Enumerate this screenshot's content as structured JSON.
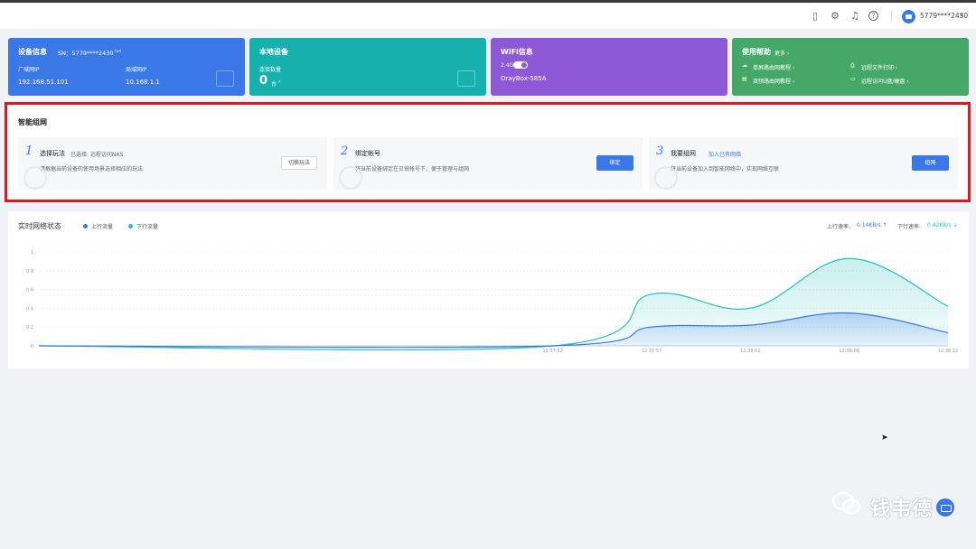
{
  "header": {
    "username": "5779****2430",
    "icons": [
      "phone-icon",
      "plugin-icon",
      "bell-icon",
      "help-icon",
      "user-avatar-icon"
    ]
  },
  "cards": {
    "device": {
      "title": "设备信息",
      "sn": "SN：5779****2430",
      "sn_tag": "fwd",
      "wan_label": "广域网IP",
      "wan_value": "192.168.51.101",
      "lan_label": "局域网IP",
      "lan_value": "10.168.1.1"
    },
    "local": {
      "title": "本地设备",
      "count_label": "连接数量",
      "count_value": "0",
      "count_unit": "台",
      "chevron": "›"
    },
    "wifi": {
      "title": "WiFi信息",
      "band": "2.4G",
      "ssid": "OrayBox-585A"
    },
    "help": {
      "title": "使用帮助",
      "more": "更多 ›",
      "links": [
        "单屏路由网教程 ›",
        "双频路由网教程 ›",
        "远程文件打印 ›",
        "远程访问U盘/硬盘 ›"
      ]
    }
  },
  "mesh": {
    "title": "智能组网",
    "steps": [
      {
        "num": "1",
        "title": "选择玩法",
        "extra": "已选择:    远程访问NAS",
        "desc": "请根据当前设备的使用场景选择相应的玩法",
        "button": "切换玩法"
      },
      {
        "num": "2",
        "title": "绑定帐号",
        "desc": "将当前设备绑定在贝锐帐号下，便于管理与组网",
        "button": "绑定"
      },
      {
        "num": "3",
        "title": "我要组网",
        "link": "加入已有网络",
        "desc": "将当前设备加入到智能网络中，实现网络互联",
        "button": "组网"
      }
    ]
  },
  "network": {
    "title": "实时网络状态",
    "legend_up": "上行流量",
    "legend_down": "下行流量",
    "up_rate_label": "上行速率:",
    "up_rate_value": "0.14KB/s ↑",
    "down_rate_label": "下行速率:",
    "down_rate_value": "0.42KB/s ↓",
    "colors": {
      "up": "#3b78e7",
      "down": "#25c1b8"
    }
  },
  "chart_data": {
    "type": "area",
    "title": "实时网络状态",
    "xlabel": "",
    "ylabel": "",
    "ylim": [
      0,
      1
    ],
    "y_ticks": [
      "0",
      "0.2",
      "0.4",
      "0.6",
      "0.8",
      "1"
    ],
    "x_ticks": [
      "12:37:52",
      "12:37:57",
      "12:38:02",
      "12:38:08",
      "12:38:12"
    ],
    "x_tick_positions": [
      0,
      5,
      10,
      15,
      20
    ],
    "x_range": [
      -26,
      20
    ],
    "grid": true,
    "legend_position": "top-left",
    "series": [
      {
        "name": "上行流量",
        "x": [
          -26,
          0,
          5,
          10,
          15,
          20
        ],
        "values": [
          0,
          0,
          0.2,
          0.22,
          0.35,
          0.14
        ]
      },
      {
        "name": "下行流量",
        "x": [
          -26,
          0,
          5,
          10,
          15,
          20
        ],
        "values": [
          0,
          0,
          0.55,
          0.4,
          0.93,
          0.42
        ]
      }
    ]
  },
  "watermark": {
    "text": "钱韦德"
  }
}
